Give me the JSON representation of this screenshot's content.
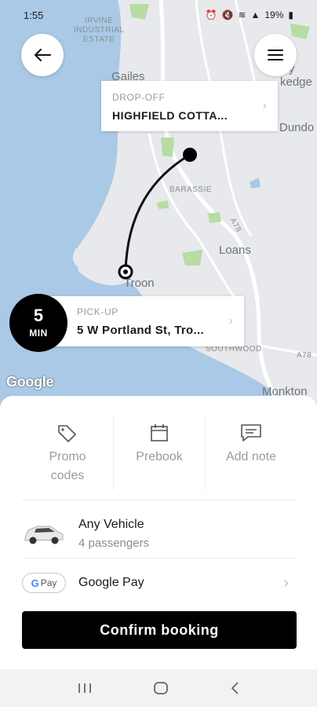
{
  "status_bar": {
    "time": "1:55",
    "battery": "19%"
  },
  "map": {
    "labels": {
      "irvine": "IRVINE",
      "industrial": "INDUSTRIAL",
      "estate": "ESTATE",
      "gailes": "Gailes",
      "dundonald_partial": "Dundo",
      "dykedge_partial": "Dy  kedge",
      "barassie": "BARASSIE",
      "a78": "A78",
      "loans": "Loans",
      "troon": "Troon",
      "southwood": "SOUTHWOOD",
      "a78_lower": "A78",
      "monkton": "Monkton",
      "google": "Google"
    },
    "colors": {
      "water": "#a9c9e6",
      "land": "#e7e9ec",
      "park": "#b7dca4"
    }
  },
  "dropoff": {
    "heading": "DROP-OFF",
    "address": "HIGHFIELD COTTA..."
  },
  "pickup": {
    "heading": "PICK-UP",
    "address": "5 W Portland St, Tro..."
  },
  "eta": {
    "value": "5",
    "unit": "MIN"
  },
  "actions": [
    {
      "icon": "tag-icon",
      "label": "Promo codes"
    },
    {
      "icon": "calendar-icon",
      "label": "Prebook"
    },
    {
      "icon": "message-icon",
      "label": "Add note"
    }
  ],
  "vehicle": {
    "title": "Any Vehicle",
    "subtitle": "4 passengers"
  },
  "payment": {
    "title": "Google Pay",
    "badge_g": "G",
    "badge_text": "Pay"
  },
  "confirm_label": "Confirm booking",
  "colors": {
    "accent": "#000000",
    "route": "#111111"
  }
}
